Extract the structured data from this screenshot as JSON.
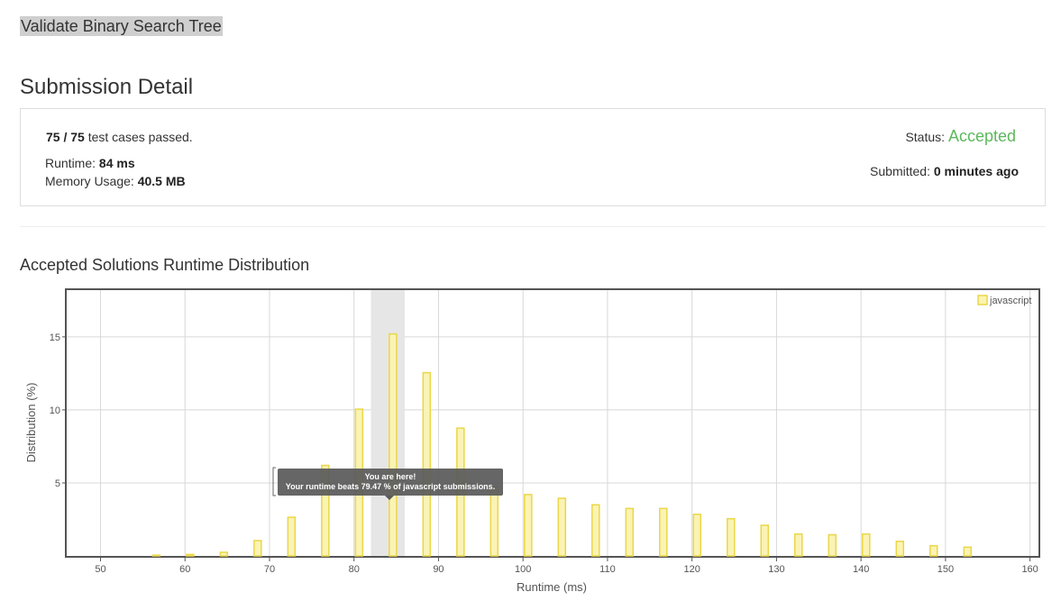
{
  "problem": {
    "title": "Validate Binary Search Tree"
  },
  "page": {
    "heading": "Submission Detail"
  },
  "detail": {
    "passed_count": "75 / 75",
    "passed_suffix": "test cases passed.",
    "runtime_label": "Runtime:",
    "runtime_value": "84 ms",
    "memory_label": "Memory Usage:",
    "memory_value": "40.5 MB",
    "status_label": "Status:",
    "status_value": "Accepted",
    "submitted_label": "Submitted:",
    "submitted_value": "0 minutes ago"
  },
  "chart_section": {
    "title": "Accepted Solutions Runtime Distribution"
  },
  "colors": {
    "accepted": "#5cb85c",
    "bar_fill": "#fbf3b4",
    "bar_stroke": "#e9d74a",
    "highlight": "#e6e6e6"
  },
  "chart_data": {
    "type": "bar",
    "xlabel": "Runtime (ms)",
    "ylabel": "Distribution (%)",
    "xlim": [
      46,
      161
    ],
    "ylim": [
      0,
      18.2
    ],
    "xticks": [
      50,
      60,
      70,
      80,
      90,
      100,
      110,
      120,
      130,
      140,
      150,
      160
    ],
    "yticks": [
      5,
      10,
      15
    ],
    "grid": true,
    "legend_position": "top-right",
    "series": [
      {
        "name": "javascript",
        "x": [
          56.6,
          60.6,
          64.6,
          68.6,
          72.6,
          76.6,
          80.6,
          84.6,
          88.6,
          92.6,
          96.6,
          100.6,
          104.6,
          108.6,
          112.6,
          116.6,
          120.6,
          124.6,
          128.6,
          132.6,
          136.6,
          140.6,
          144.6,
          148.6,
          152.6
        ],
        "values": [
          0.05,
          0.1,
          0.25,
          1.05,
          2.65,
          6.2,
          10.05,
          15.2,
          12.55,
          8.75,
          4.7,
          4.2,
          3.95,
          3.5,
          3.25,
          3.25,
          2.85,
          2.55,
          2.1,
          1.5,
          1.45,
          1.5,
          1.0,
          0.7,
          0.6
        ]
      }
    ],
    "highlight_range": [
      82,
      86
    ],
    "tooltip": {
      "line1": "You are here!",
      "line2": "Your runtime beats 79.47 % of javascript submissions."
    }
  }
}
